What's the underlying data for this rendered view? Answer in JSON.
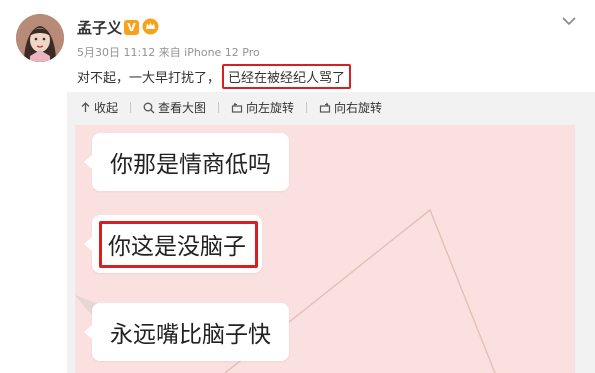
{
  "user": {
    "name": "孟子义",
    "verified_badge": "V",
    "accent_verified": "#f7a21b"
  },
  "post": {
    "meta": "5月30日 11:12 来自 iPhone 12 Pro",
    "text_prefix": "对不起，一大早打扰了，",
    "text_highlight": "已经在被经纪人骂了",
    "highlight_color": "#d92020"
  },
  "toolbar": {
    "collapse": "收起",
    "view_large": "查看大图",
    "rotate_left": "向左旋转",
    "rotate_right": "向右旋转"
  },
  "image": {
    "background": "#fbe0e0",
    "bubbles": [
      {
        "text": "你那是情商低吗"
      },
      {
        "text": "你这是没脑子",
        "highlighted": true
      },
      {
        "text": "永远嘴比脑子快"
      }
    ]
  }
}
